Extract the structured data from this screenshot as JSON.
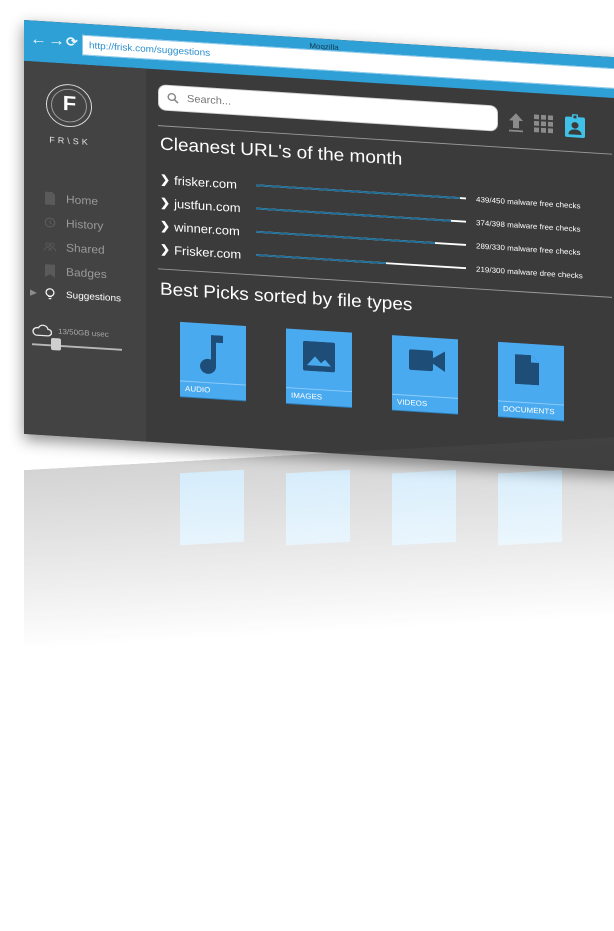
{
  "browser": {
    "title": "Moqzilla",
    "url": "http://frisk.com/suggestions",
    "accent": "#2ea0d6"
  },
  "sidebar": {
    "logo_letter": "F",
    "logo_text": "FR\\SK",
    "items": [
      {
        "label": "Home",
        "icon": "document-icon"
      },
      {
        "label": "History",
        "icon": "history-icon"
      },
      {
        "label": "Shared",
        "icon": "people-icon"
      },
      {
        "label": "Badges",
        "icon": "bookmark-icon"
      },
      {
        "label": "Suggestions",
        "icon": "lightbulb-icon",
        "active": true
      }
    ],
    "storage_text": "13/50GB usec",
    "storage_fraction": 0.26
  },
  "search": {
    "placeholder": "Search..."
  },
  "toolbar": {
    "icons": [
      "upload-icon",
      "grid-icon",
      "badge-icon"
    ]
  },
  "cleanest": {
    "title": "Cleanest URL's of the month",
    "rows": [
      {
        "name": "frisker.com",
        "stat": "439/450 malware free checks",
        "ratio": 0.97
      },
      {
        "name": "justfun.com",
        "stat": "374/398 malware free checks",
        "ratio": 0.93
      },
      {
        "name": "winner.com",
        "stat": "289/330 malware free checks",
        "ratio": 0.85
      },
      {
        "name": "Frisker.com",
        "stat": "219/300 malware dree checks",
        "ratio": 0.62
      }
    ]
  },
  "best_picks": {
    "title": "Best Picks sorted by file types",
    "tiles": [
      {
        "label": "AUDIO",
        "icon": "music-note-icon"
      },
      {
        "label": "IMAGES",
        "icon": "image-icon"
      },
      {
        "label": "VIDEOS",
        "icon": "video-camera-icon"
      },
      {
        "label": "DOCUMENTS",
        "icon": "document-icon"
      }
    ]
  }
}
